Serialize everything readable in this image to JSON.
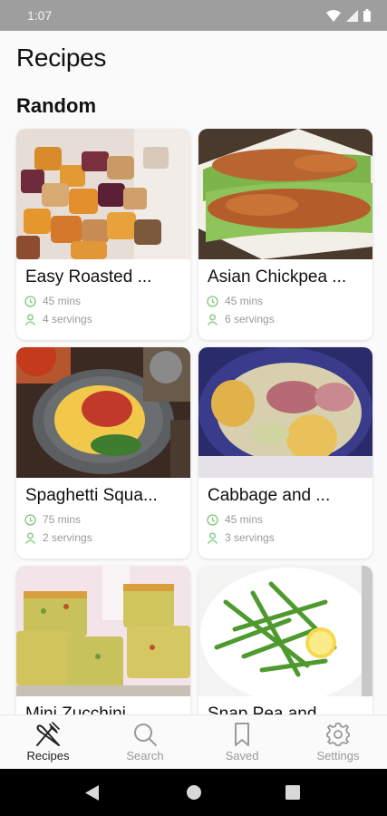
{
  "status_bar": {
    "time": "1:07"
  },
  "header": {
    "title": "Recipes"
  },
  "section": {
    "title": "Random"
  },
  "recipes": [
    {
      "title": "Easy Roasted ...",
      "time": "45 mins",
      "servings": "4 servings"
    },
    {
      "title": "Asian Chickpea ...",
      "time": "45 mins",
      "servings": "6 servings"
    },
    {
      "title": "Spaghetti Squa...",
      "time": "75 mins",
      "servings": "2 servings"
    },
    {
      "title": "Cabbage and ...",
      "time": "45 mins",
      "servings": "3 servings"
    },
    {
      "title": "Mini Zucchini",
      "time": "",
      "servings": ""
    },
    {
      "title": "Snap Pea and",
      "time": "",
      "servings": ""
    }
  ],
  "tabs": [
    {
      "label": "Recipes",
      "icon": "fork-knife-icon",
      "active": true
    },
    {
      "label": "Search",
      "icon": "search-icon",
      "active": false
    },
    {
      "label": "Saved",
      "icon": "bookmark-icon",
      "active": false
    },
    {
      "label": "Settings",
      "icon": "gear-icon",
      "active": false
    }
  ],
  "colors": {
    "accent_green": "#7cc87c",
    "status_bar": "#9e9e9e",
    "meta_gray": "#9a9a9a"
  }
}
